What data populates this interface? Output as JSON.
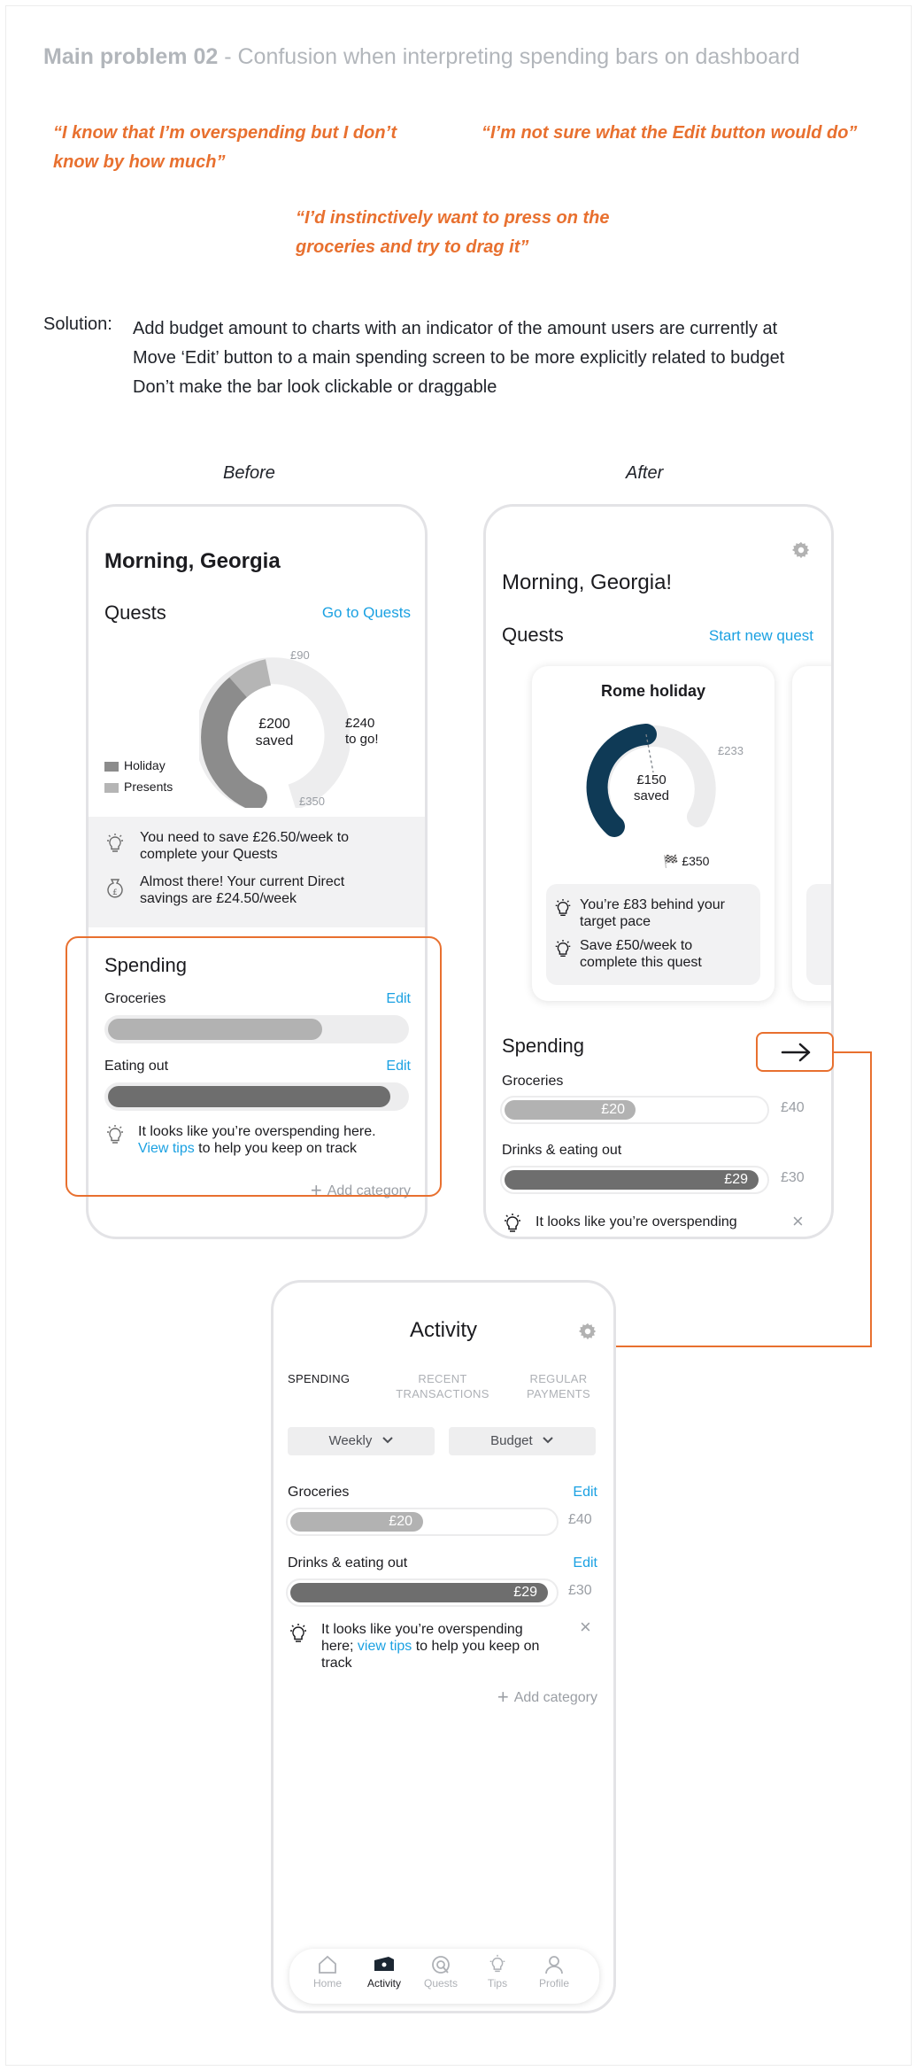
{
  "header": {
    "title_bold": "Main problem 02",
    "title_rest": " - Confusion when interpreting spending bars on dashboard"
  },
  "quotes": {
    "q1_line1": "“I know that I’m overspending but I don’t",
    "q1_line2": "know by how much”",
    "q2": "“I’m not sure what the Edit button would do”",
    "q3_line1": "“I’d instinctively want to press on the",
    "q3_line2": "groceries and try to drag it”"
  },
  "solution": {
    "label": "Solution:",
    "line1": "Add budget amount to charts with an indicator of the amount users are currently at",
    "line2": "Move ‘Edit’ button to a main spending screen to be more explicitly related to budget",
    "line3": "Don’t make the bar look clickable or draggable"
  },
  "labels": {
    "before": "Before",
    "after": "After"
  },
  "colors": {
    "accent_orange": "#e8702f",
    "link_blue": "#1ba1e2",
    "quest_navy": "#0f3a56",
    "bar_light": "#b2b2b2",
    "bar_dark": "#6e6e6e"
  },
  "before": {
    "greeting": "Morning, Georgia",
    "quests_title": "Quests",
    "go_to_quests": "Go to Quests",
    "donut": {
      "center_amount": "£200",
      "center_label": "saved",
      "remaining_amount": "£240",
      "remaining_label": "to go!",
      "mark_top": "£90",
      "mark_bottom": "£350",
      "legend": [
        "Holiday",
        "Presents"
      ],
      "holiday_value": 110,
      "presents_value": 90,
      "target": 350
    },
    "tip1_line1": "You need to save £26.50/week to",
    "tip1_line2": "complete your Quests",
    "tip2_line1": "Almost there! Your current Direct",
    "tip2_line2": "savings are £24.50/week",
    "spending_title": "Spending",
    "edit": "Edit",
    "groceries": "Groceries",
    "groceries_fill": 0.72,
    "eating_out": "Eating out",
    "eating_out_fill": 0.95,
    "overspend_line1": "It looks like you’re overspending here.",
    "view_tips": "View tips",
    "overspend_rest": " to help you keep on track",
    "add_category": "Add category"
  },
  "after": {
    "greeting": "Morning, Georgia!",
    "quests_title": "Quests",
    "start_new_quest": "Start new quest",
    "card_title": "Rome holiday",
    "gauge": {
      "center_amount": "£150",
      "center_label": "saved",
      "pace_mark": "£233",
      "target_mark": "🏁 £350",
      "saved": 150,
      "target": 350
    },
    "tip1_line1": "You’re £83 behind your",
    "tip1_line2": "target pace",
    "tip2_line1": "Save £50/week to",
    "tip2_line2": "complete this quest",
    "spending_title": "Spending",
    "groceries": "Groceries",
    "groceries_value": "£20",
    "groceries_budget": "£40",
    "groceries_fill": 0.5,
    "drinks": "Drinks & eating out",
    "drinks_value": "£29",
    "drinks_budget": "£30",
    "drinks_fill": 0.97,
    "overspend": "It looks like you’re overspending"
  },
  "activity": {
    "title": "Activity",
    "tabs": [
      "SPENDING",
      "RECENT TRANSACTIONS",
      "REGULAR PAYMENTS"
    ],
    "tab_recent_1": "RECENT",
    "tab_recent_2": "TRANSACTIONS",
    "tab_regular_1": "REGULAR",
    "tab_regular_2": "PAYMENTS",
    "weekly": "Weekly",
    "budget": "Budget",
    "groceries": "Groceries",
    "groceries_value": "£20",
    "groceries_budget": "£40",
    "groceries_fill": 0.5,
    "drinks": "Drinks & eating out",
    "drinks_value": "£29",
    "drinks_budget": "£30",
    "drinks_fill": 0.97,
    "edit": "Edit",
    "tip_line1": "It looks like you’re overspending",
    "tip_line2_pre": "here; ",
    "view_tips": "view tips",
    "tip_line2_post": " to help you keep on",
    "tip_line3": "track",
    "add_category": "Add category",
    "nav": [
      "Home",
      "Activity",
      "Quests",
      "Tips",
      "Profile"
    ],
    "nav_active": "Activity"
  }
}
